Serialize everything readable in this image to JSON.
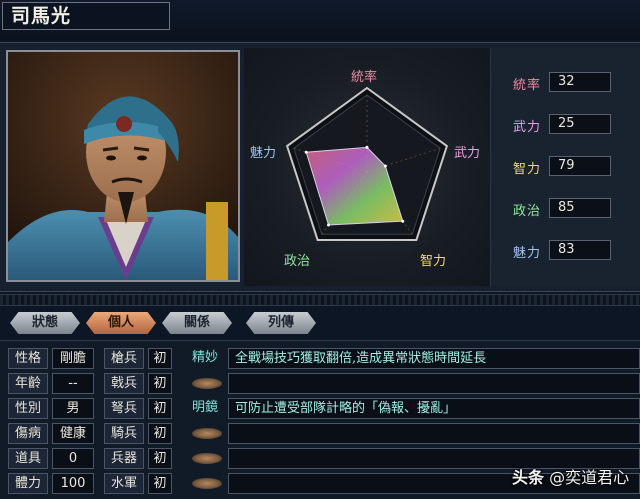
{
  "officer": {
    "name": "司馬光"
  },
  "radar": {
    "labels": {
      "leadership": "統率",
      "war": "武力",
      "intelligence": "智力",
      "politics": "政治",
      "charm": "魅力"
    }
  },
  "stats": [
    {
      "label": "統率",
      "value": "32",
      "color": "#f08aa0"
    },
    {
      "label": "武力",
      "value": "25",
      "color": "#e9a0e6"
    },
    {
      "label": "智力",
      "value": "79",
      "color": "#f0dc6a"
    },
    {
      "label": "政治",
      "value": "85",
      "color": "#8fe89a"
    },
    {
      "label": "魅力",
      "value": "83",
      "color": "#9fc4f0"
    }
  ],
  "chart_data": {
    "type": "radar",
    "categories": [
      "統率",
      "武力",
      "智力",
      "政治",
      "魅力"
    ],
    "values": [
      32,
      25,
      79,
      85,
      83
    ],
    "ylim": [
      0,
      100
    ]
  },
  "tabs": [
    {
      "label": "狀態",
      "active": false
    },
    {
      "label": "個人",
      "active": true
    },
    {
      "label": "關係",
      "active": false
    },
    {
      "label": "列傳",
      "active": false
    }
  ],
  "profile": [
    {
      "label": "性格",
      "value": "剛膽"
    },
    {
      "label": "年齡",
      "value": "--"
    },
    {
      "label": "性別",
      "value": "男"
    },
    {
      "label": "傷病",
      "value": "健康"
    },
    {
      "label": "道具",
      "value": "0"
    },
    {
      "label": "體力",
      "value": "100"
    }
  ],
  "aptitudes": [
    {
      "label": "槍兵",
      "value": "初"
    },
    {
      "label": "戟兵",
      "value": "初"
    },
    {
      "label": "弩兵",
      "value": "初"
    },
    {
      "label": "騎兵",
      "value": "初"
    },
    {
      "label": "兵器",
      "value": "初"
    },
    {
      "label": "水軍",
      "value": "初"
    }
  ],
  "skills": [
    {
      "name": "精妙",
      "desc": "全戰場技巧獲取翻倍,造成異常狀態時間延長"
    },
    {
      "name": "",
      "desc": ""
    },
    {
      "name": "明鏡",
      "desc": "可防止遭受部隊計略的「偽報、擾亂」"
    },
    {
      "name": "",
      "desc": ""
    },
    {
      "name": "",
      "desc": ""
    },
    {
      "name": "",
      "desc": ""
    }
  ],
  "watermark": {
    "brand": "头条",
    "account": "@奕道君心"
  }
}
